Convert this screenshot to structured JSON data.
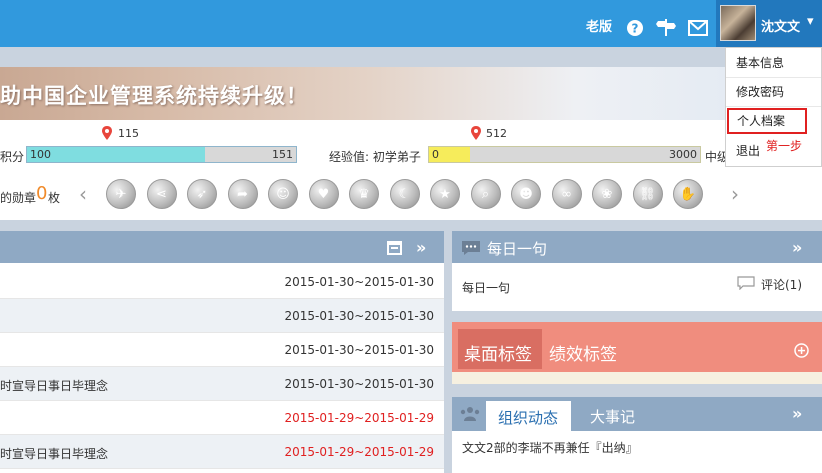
{
  "header": {
    "old_version_label": "老版",
    "help_icon": "question-circle-icon",
    "feedback_icon": "signpost-icon",
    "mail_icon": "envelope-icon",
    "username": "沈文文",
    "caret": "▾"
  },
  "user_menu": {
    "items": [
      "基本信息",
      "修改密码",
      "个人档案",
      "退出"
    ],
    "highlighted": "个人档案",
    "step_note": "第一步"
  },
  "banner": {
    "text": "助中国企业管理系统持续升级！"
  },
  "stats": {
    "points": {
      "label": "积分",
      "marker_value": "115",
      "current": "100",
      "max": "151",
      "progress": 0.66
    },
    "experience": {
      "label": "经验值: 初学弟子",
      "marker_value": "512",
      "current": "0",
      "max": "3000",
      "progress": 0.15,
      "suffix": "中级"
    },
    "medals": {
      "prefix": "的勋章",
      "count": "0",
      "unit": "枚",
      "prev": "‹",
      "next": "›",
      "icons": [
        "plane-medal-icon",
        "share-medal-icon",
        "rocket-medal-icon",
        "arrow-medal-icon",
        "face-medal-icon",
        "heart-medal-icon",
        "crown-medal-icon",
        "moon-medal-icon",
        "star-medal-icon",
        "search-medal-icon",
        "clown-medal-icon",
        "ring-medal-icon",
        "rabbit-medal-icon",
        "chain-medal-icon",
        "hand-medal-icon"
      ]
    }
  },
  "left_panel": {
    "header_icons": [
      "calendar-icon",
      "double-chevron-icon"
    ],
    "rows": [
      {
        "text": "",
        "date": "2015-01-30~2015-01-30",
        "date_color": "#333333"
      },
      {
        "text": "",
        "date": "2015-01-30~2015-01-30",
        "date_color": "#333333"
      },
      {
        "text": "",
        "date": "2015-01-30~2015-01-30",
        "date_color": "#333333"
      },
      {
        "text": "时宣导日事日毕理念",
        "date": "2015-01-30~2015-01-30",
        "date_color": "#333333"
      },
      {
        "text": "",
        "date": "2015-01-29~2015-01-29",
        "date_color": "#e02020"
      },
      {
        "text": "时宣导日事日毕理念",
        "date": "2015-01-29~2015-01-29",
        "date_color": "#e02020"
      }
    ]
  },
  "daily_quote": {
    "title": "每日一句",
    "content": "每日一句",
    "comment_label": "评论(1)"
  },
  "tags_panel": {
    "tabs": [
      "桌面标签",
      "绩效标签"
    ],
    "active": "桌面标签",
    "add_icon": "plus-circle-icon"
  },
  "org_panel": {
    "tabs": [
      "组织动态",
      "大事记"
    ],
    "active": "组织动态",
    "item": "文文2部的李瑞不再兼任『出纳』"
  },
  "colors": {
    "topbar": "#3199dd",
    "panel_header": "#8fa9c4",
    "points_fill": "#7fdde0",
    "exp_fill": "#f6ec5b",
    "tags_bg": "#f08d7e",
    "highlight_border": "#e02020"
  }
}
